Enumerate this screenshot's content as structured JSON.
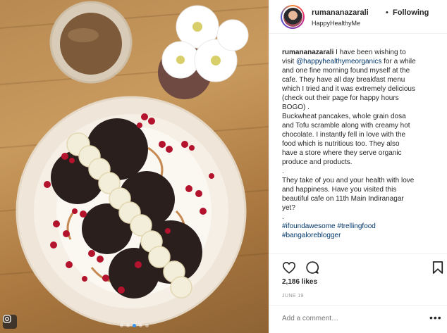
{
  "post": {
    "username": "rumananazarali",
    "separator": "•",
    "follow_status": "Following",
    "location": "HappyHealthyMe"
  },
  "caption": {
    "lines": [
      {
        "parts": [
          {
            "t": "rumananazarali",
            "k": "u"
          },
          {
            "t": " I have been wishing to",
            "k": ""
          }
        ]
      },
      {
        "parts": [
          {
            "t": "visit ",
            "k": ""
          },
          {
            "t": "@happyhealthymeorganics",
            "k": "link"
          },
          {
            "t": " for a while",
            "k": ""
          }
        ]
      },
      {
        "parts": [
          {
            "t": "and one fine morning found myself at the",
            "k": ""
          }
        ]
      },
      {
        "parts": [
          {
            "t": "cafe. They have all day breakfast menu",
            "k": ""
          }
        ]
      },
      {
        "parts": [
          {
            "t": "which I tried and it was extremely delicious",
            "k": ""
          }
        ]
      },
      {
        "parts": [
          {
            "t": "(check out their page for happy hours",
            "k": ""
          }
        ]
      },
      {
        "parts": [
          {
            "t": "BOGO) .",
            "k": ""
          }
        ]
      },
      {
        "parts": [
          {
            "t": "Buckwheat pancakes, whole grain dosa",
            "k": ""
          }
        ]
      },
      {
        "parts": [
          {
            "t": "and Tofu scramble along with creamy hot",
            "k": ""
          }
        ]
      },
      {
        "parts": [
          {
            "t": "chocolate. I instantly fell in love with the",
            "k": ""
          }
        ]
      },
      {
        "parts": [
          {
            "t": "food which is nutritious too. They also",
            "k": ""
          }
        ]
      },
      {
        "parts": [
          {
            "t": "have a store where they serve organic",
            "k": ""
          }
        ]
      },
      {
        "parts": [
          {
            "t": "produce and products.",
            "k": ""
          }
        ]
      },
      {
        "parts": [
          {
            "t": ".",
            "k": ""
          }
        ]
      },
      {
        "parts": [
          {
            "t": "They take of you and your health with love",
            "k": ""
          }
        ]
      },
      {
        "parts": [
          {
            "t": "and happiness. Have you visited this",
            "k": ""
          }
        ]
      },
      {
        "parts": [
          {
            "t": "beautiful cafe on 11th Main Indiranagar",
            "k": ""
          }
        ]
      },
      {
        "parts": [
          {
            "t": "yet?",
            "k": ""
          }
        ]
      },
      {
        "parts": [
          {
            "t": ".",
            "k": ""
          }
        ]
      },
      {
        "parts": [
          {
            "t": "#ifoundawesome",
            "k": "link"
          },
          {
            "t": " ",
            "k": ""
          },
          {
            "t": "#trellingfood",
            "k": "link"
          }
        ]
      },
      {
        "parts": [
          {
            "t": "#bangaloreblogger",
            "k": "link"
          }
        ]
      }
    ]
  },
  "actions": {
    "like_icon": "heart-outline-icon",
    "comment_icon": "comment-bubble-icon",
    "save_icon": "bookmark-icon"
  },
  "likes": "2,186 likes",
  "date": "JUNE 19",
  "comment": {
    "placeholder": "Add a comment…",
    "more_label": "•••"
  },
  "carousel": {
    "count": 5,
    "active_index": 2
  },
  "colors": {
    "link": "#003569",
    "meta": "#999999",
    "border": "#efefef",
    "carousel_active": "#3897f0"
  }
}
